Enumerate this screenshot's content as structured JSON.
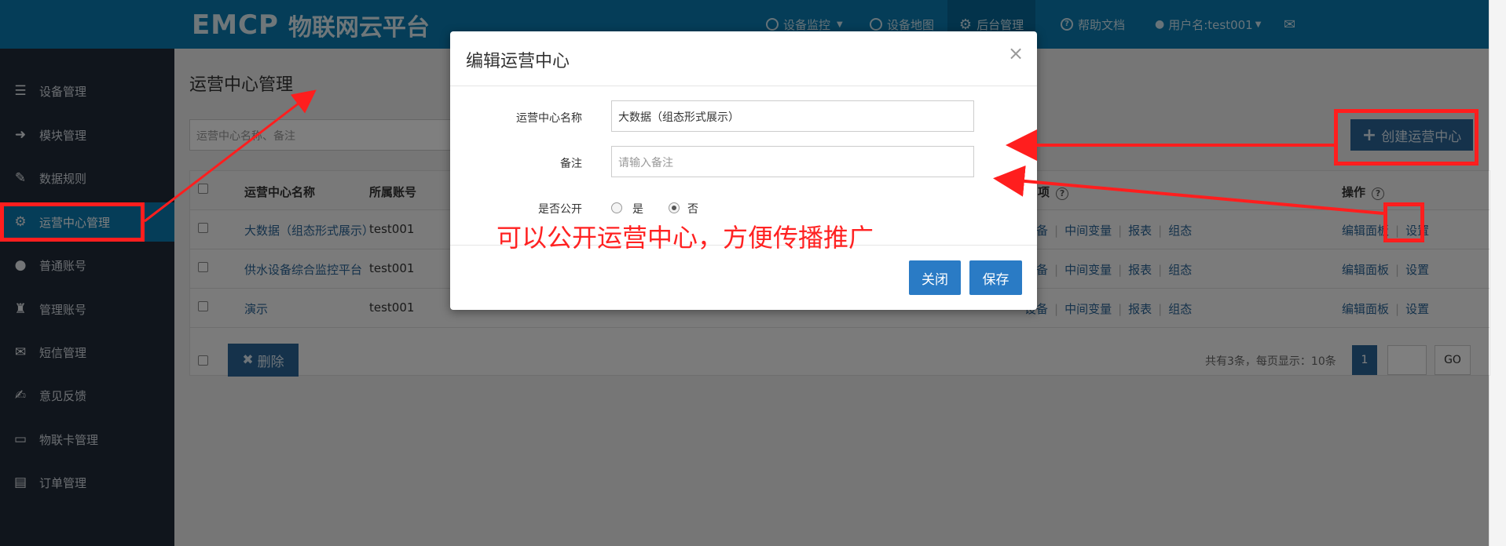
{
  "brand": {
    "logo_mark": "EMCP",
    "logo_text": "物联网云平台"
  },
  "nav": {
    "device_monitor": "设备监控",
    "device_map": "设备地图",
    "backend": "后台管理",
    "help_docs": "帮助文档",
    "username": "用户名:test001"
  },
  "sidebar": {
    "items": [
      {
        "label": "设备管理",
        "icon": "list-icon"
      },
      {
        "label": "模块管理",
        "icon": "sign-in-icon"
      },
      {
        "label": "数据规则",
        "icon": "pencil-icon"
      },
      {
        "label": "运营中心管理",
        "icon": "cog-icon"
      },
      {
        "label": "普通账号",
        "icon": "user-icon"
      },
      {
        "label": "管理账号",
        "icon": "admin-user-icon"
      },
      {
        "label": "短信管理",
        "icon": "envelope-icon"
      },
      {
        "label": "意见反馈",
        "icon": "edit-icon"
      },
      {
        "label": "物联卡管理",
        "icon": "card-icon"
      },
      {
        "label": "订单管理",
        "icon": "order-icon"
      }
    ]
  },
  "page": {
    "title": "运营中心管理",
    "search_placeholder": "运营中心名称、备注",
    "create_label": "创建运营中心"
  },
  "table": {
    "headers": {
      "name": "运营中心名称",
      "account": "所属账号",
      "options": "项",
      "actions": "操作"
    },
    "rows": [
      {
        "name": "大数据（组态形式展示）",
        "account": "test001",
        "opt1": "设备",
        "opt2": "中间变量",
        "opt3": "报表",
        "opt4": "组态",
        "act1": "编辑面板",
        "act2": "设置"
      },
      {
        "name": "供水设备综合监控平台",
        "account": "test001",
        "opt1": "设备",
        "opt2": "中间变量",
        "opt3": "报表",
        "opt4": "组态",
        "act1": "编辑面板",
        "act2": "设置"
      },
      {
        "name": "演示",
        "account": "test001",
        "opt1": "设备",
        "opt2": "中间变量",
        "opt3": "报表",
        "opt4": "组态",
        "act1": "编辑面板",
        "act2": "设置"
      }
    ],
    "delete_label": "删除",
    "pager_text": "共有3条，每页显示：10条",
    "current_page": "1",
    "go_label": "GO"
  },
  "modal": {
    "title": "编辑运营中心",
    "close": "×",
    "name_label": "运营中心名称",
    "name_value": "大数据（组态形式展示）",
    "remark_label": "备注",
    "remark_placeholder": "请输入备注",
    "public_label": "是否公开",
    "yes": "是",
    "no": "否",
    "close_button": "关闭",
    "save_button": "保存"
  },
  "annotation": "可以公开运营中心，方便传播推广",
  "colors": {
    "header": "#0a7bb0",
    "sidebar": "#212b38",
    "primary_button": "#2a6496",
    "highlight": "#ff1e1e"
  }
}
